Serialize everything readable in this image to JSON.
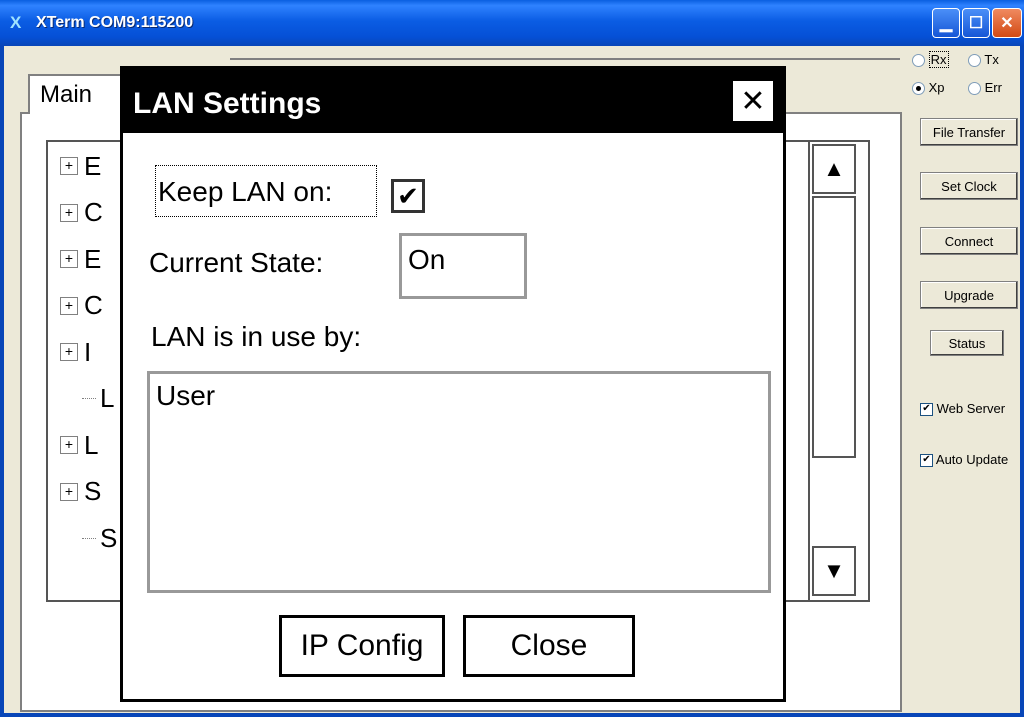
{
  "window": {
    "title": "XTerm COM9:115200",
    "icon_glyph": "X"
  },
  "titlebar_buttons": {
    "minimize": "▁",
    "maximize": "☐",
    "close": "✕"
  },
  "main_tab": {
    "label": "Main"
  },
  "tree": {
    "items": [
      {
        "label": "E",
        "expandable": true
      },
      {
        "label": "C",
        "expandable": true
      },
      {
        "label": "E",
        "expandable": true
      },
      {
        "label": "C",
        "expandable": true
      },
      {
        "label": "I",
        "expandable": true
      },
      {
        "label": "L",
        "expandable": false
      },
      {
        "label": "L",
        "expandable": true
      },
      {
        "label": "S",
        "expandable": true
      },
      {
        "label": "S",
        "expandable": false
      }
    ],
    "scroll_up": "▲",
    "scroll_down": "▼"
  },
  "dialog": {
    "title": "LAN Settings",
    "close_glyph": "✕",
    "keep_lan_label": "Keep LAN on:",
    "keep_lan_checked": "✔",
    "current_state_label": "Current State:",
    "current_state_value": "On",
    "in_use_label": "LAN is in use by:",
    "in_use_list": [
      "User"
    ],
    "ip_config_button": "IP Config",
    "close_button": "Close"
  },
  "right_panel": {
    "radios": [
      {
        "label": "Rx",
        "checked": false
      },
      {
        "label": "Tx",
        "checked": false
      },
      {
        "label": "Xp",
        "checked": true
      },
      {
        "label": "Err",
        "checked": false
      }
    ],
    "buttons": {
      "file_transfer": "File Transfer",
      "set_clock": "Set Clock",
      "connect": "Connect",
      "upgrade": "Upgrade",
      "status": "Status"
    },
    "checkboxes": {
      "web_server": {
        "label": "Web Server",
        "mark": "✔"
      },
      "auto_update": {
        "label": "Auto Update",
        "mark": "✔"
      }
    }
  },
  "colors": {
    "titlebar": "#0b5de4",
    "frame": "#0846b8",
    "panel_bg": "#ece9d8"
  }
}
